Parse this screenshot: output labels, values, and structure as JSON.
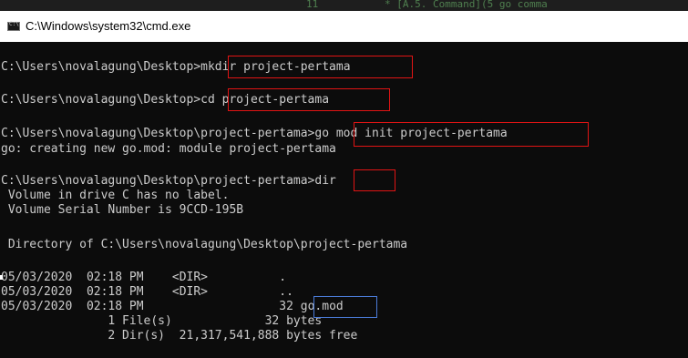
{
  "background_editor": {
    "line_number": "11",
    "code_snippet": "* [A.5. Command](5 go comma"
  },
  "window": {
    "title": "C:\\Windows\\system32\\cmd.exe",
    "icon": "cmd-app-icon"
  },
  "console": {
    "prompt": "C:\\Users\\novalagung\\Desktop>",
    "project_prompt": "C:\\Users\\novalagung\\Desktop\\project-pertama>",
    "cmd_mkdir": "mkdir project-pertama",
    "cmd_cd": "cd project-pertama",
    "cmd_gomod": "go mod init project-pertama",
    "gomod_output": "go: creating new go.mod: module project-pertama",
    "cmd_dir": "dir",
    "volume_label": " Volume in drive C has no label.",
    "volume_serial": " Volume Serial Number is 9CCD-195B",
    "directory_of": " Directory of C:\\Users\\novalagung\\Desktop\\project-pertama",
    "entries": [
      {
        "date": "05/03/2020",
        "time": "02:18 PM",
        "type": "<DIR>",
        "size": "",
        "name": "."
      },
      {
        "date": "05/03/2020",
        "time": "02:18 PM",
        "type": "<DIR>",
        "size": "",
        "name": ".."
      },
      {
        "date": "05/03/2020",
        "time": "02:18 PM",
        "type": "",
        "size": "32",
        "name": "go.mod"
      }
    ],
    "summary_files": "               1 File(s)             32 bytes",
    "summary_dirs": "               2 Dir(s)  21,317,541,888 bytes free"
  },
  "colors": {
    "console_bg": "#0c0c0c",
    "console_text": "#cccccc",
    "highlight_red": "#e01414",
    "highlight_blue": "#4b7bd8"
  }
}
